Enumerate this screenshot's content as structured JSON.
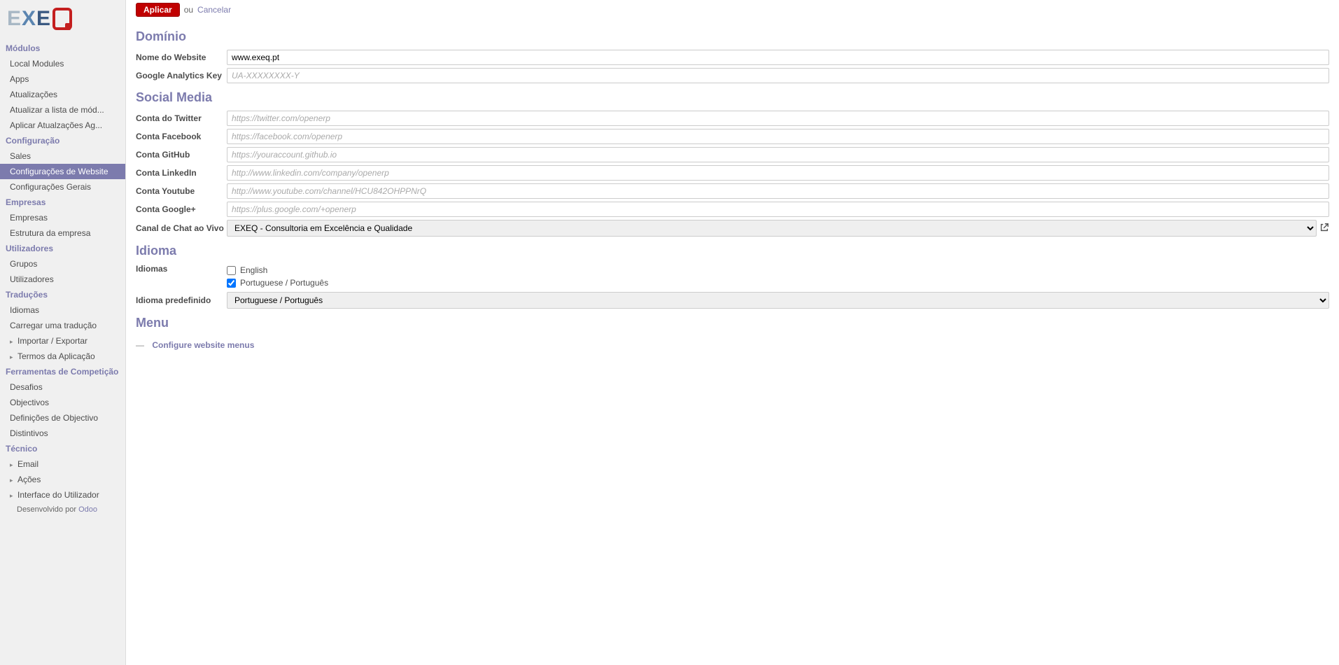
{
  "logo": {
    "part1": "E",
    "part2": "X",
    "part3": "E"
  },
  "actionbar": {
    "apply_label": "Aplicar",
    "or_text": "ou",
    "cancel_label": "Cancelar"
  },
  "sidebar": {
    "sections": [
      {
        "title": "Módulos",
        "items": [
          {
            "label": "Local Modules"
          },
          {
            "label": "Apps"
          },
          {
            "label": "Atualizações"
          },
          {
            "label": "Atualizar a lista de mód..."
          },
          {
            "label": "Aplicar Atualzações Ag..."
          }
        ]
      },
      {
        "title": "Configuração",
        "items": [
          {
            "label": "Sales"
          },
          {
            "label": "Configurações de Website",
            "active": true
          },
          {
            "label": "Configurações Gerais"
          }
        ]
      },
      {
        "title": "Empresas",
        "items": [
          {
            "label": "Empresas"
          },
          {
            "label": "Estrutura da empresa"
          }
        ]
      },
      {
        "title": "Utilizadores",
        "items": [
          {
            "label": "Grupos"
          },
          {
            "label": "Utilizadores"
          }
        ]
      },
      {
        "title": "Traduções",
        "items": [
          {
            "label": "Idiomas"
          },
          {
            "label": "Carregar uma tradução"
          },
          {
            "label": "Importar / Exportar",
            "expand": true
          },
          {
            "label": "Termos da Aplicação",
            "expand": true
          }
        ]
      },
      {
        "title": "Ferramentas de Competição",
        "items": [
          {
            "label": "Desafios"
          },
          {
            "label": "Objectivos"
          },
          {
            "label": "Definições de Objectivo"
          },
          {
            "label": "Distintivos"
          }
        ]
      },
      {
        "title": "Técnico",
        "items": [
          {
            "label": "Email",
            "expand": true
          },
          {
            "label": "Ações",
            "expand": true
          },
          {
            "label": "Interface do Utilizador",
            "expand": true
          }
        ]
      }
    ],
    "footer_prefix": "Desenvolvido por ",
    "footer_link": "Odoo"
  },
  "sections": {
    "dominio": {
      "title": "Domínio",
      "website_label": "Nome do Website",
      "website_value": "www.exeq.pt",
      "ga_label": "Google Analytics Key",
      "ga_placeholder": "UA-XXXXXXXX-Y"
    },
    "social": {
      "title": "Social Media",
      "twitter_label": "Conta do Twitter",
      "twitter_placeholder": "https://twitter.com/openerp",
      "facebook_label": "Conta Facebook",
      "facebook_placeholder": "https://facebook.com/openerp",
      "github_label": "Conta GitHub",
      "github_placeholder": "https://youraccount.github.io",
      "linkedin_label": "Conta LinkedIn",
      "linkedin_placeholder": "http://www.linkedin.com/company/openerp",
      "youtube_label": "Conta Youtube",
      "youtube_placeholder": "http://www.youtube.com/channel/HCU842OHPPNrQ",
      "google_label": "Conta Google+",
      "google_placeholder": "https://plus.google.com/+openerp",
      "chat_label": "Canal de Chat ao Vivo",
      "chat_value": "EXEQ - Consultoria em Excelência e Qualidade"
    },
    "idioma": {
      "title": "Idioma",
      "languages_label": "Idiomas",
      "lang_en": "English",
      "lang_pt": "Portuguese / Português",
      "default_label": "Idioma predefinido",
      "default_value": "Portuguese / Português"
    },
    "menu": {
      "title": "Menu",
      "dash": "—",
      "link": "Configure website menus"
    }
  }
}
